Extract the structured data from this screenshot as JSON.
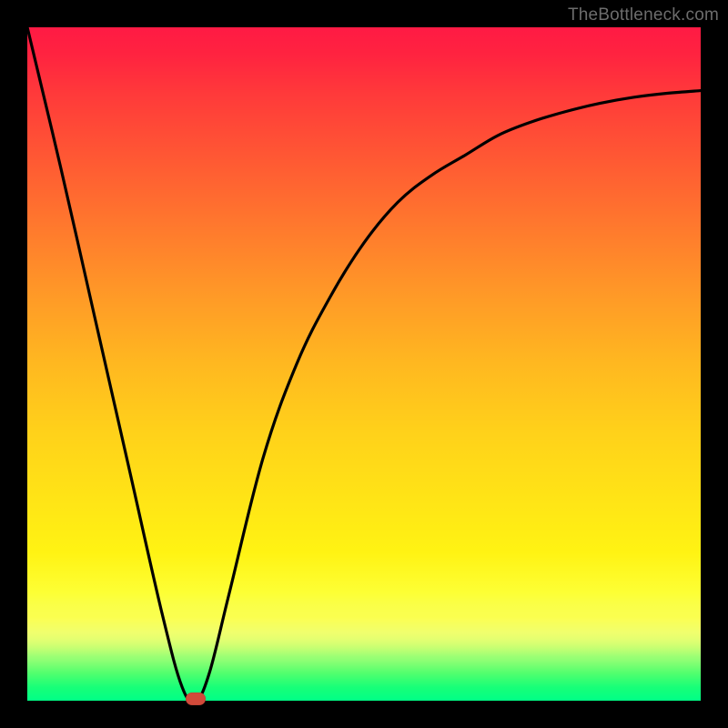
{
  "watermark": "TheBottleneck.com",
  "colors": {
    "background": "#000000",
    "curve": "#000000",
    "marker": "#d14a3a"
  },
  "chart_data": {
    "type": "line",
    "title": "",
    "xlabel": "",
    "ylabel": "",
    "xlim": [
      0,
      100
    ],
    "ylim": [
      0,
      100
    ],
    "grid": false,
    "legend": false,
    "series": [
      {
        "name": "curve",
        "x": [
          0,
          5,
          10,
          15,
          20,
          23,
          25,
          27,
          30,
          35,
          40,
          45,
          50,
          55,
          60,
          65,
          70,
          75,
          80,
          85,
          90,
          95,
          100
        ],
        "y": [
          100,
          79,
          57,
          35,
          13,
          2,
          0,
          4,
          16,
          36,
          50,
          60,
          68,
          74,
          78,
          81,
          84,
          86,
          87.5,
          88.7,
          89.6,
          90.2,
          90.6
        ]
      }
    ],
    "marker": {
      "x": 25,
      "y": 0
    }
  }
}
